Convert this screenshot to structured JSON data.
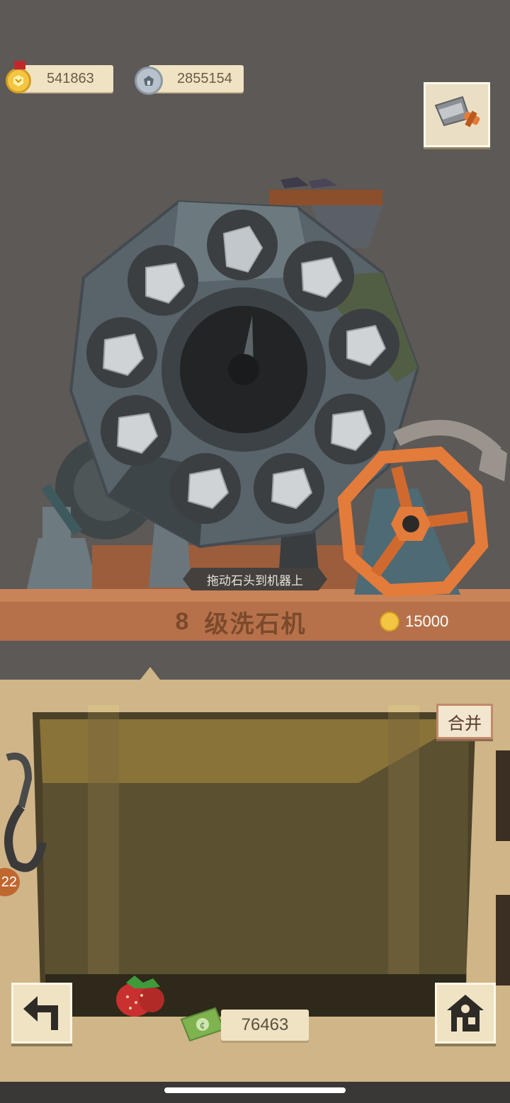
{
  "hud": {
    "gold_medals": "541863",
    "silver_coins": "2855154"
  },
  "machine": {
    "instruction": "拖动石头到机器上",
    "level": "8",
    "title": "级洗石机",
    "upgrade_cost": "15000"
  },
  "inventory": {
    "merge_label": "合并",
    "cash": "76463",
    "side_badge": "22"
  },
  "icons": {
    "gold": "medal-icon",
    "silver": "coin-icon",
    "tool": "saw-icon",
    "back": "back-arrow-icon",
    "home": "house-icon",
    "cash": "cash-icon",
    "fruit": "strawberry-icon"
  },
  "colors": {
    "background": "#5d5956",
    "wheel": "#4b5256",
    "crank": "#e37b3a",
    "panel": "#cfb588",
    "sack": "#5b5030"
  }
}
